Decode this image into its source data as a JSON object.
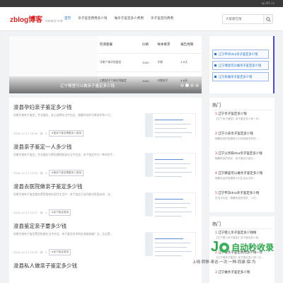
{
  "topbar": {
    "right_text": "sp.0f1.cn"
  },
  "header": {
    "logo_main": "zblog",
    "logo_brand": "博客",
    "slogan": "代码笔记·分享",
    "nav": [
      {
        "label": "首页",
        "active": true
      },
      {
        "label": "亲子鉴定费用多少钱",
        "active": false
      },
      {
        "label": "做亲子鉴定多少费用",
        "active": false
      },
      {
        "label": "亲子鉴定的费用",
        "active": false
      }
    ],
    "search_placeholder": "大家都在搜"
  },
  "slider": {
    "table_headers": [
      "检测套餐",
      "价格",
      "样本要求",
      "报告周期"
    ],
    "table_rows": [
      [
        "牙刷个体识别鉴定",
        "3000",
        "牙刷",
        "4-6天"
      ],
      [
        "口腔拭子个体识别鉴定",
        "3000",
        "口腔拭子",
        "4-6天"
      ]
    ],
    "caption": "辽宁哪里可以做亲子鉴定多少钱",
    "dots": 4,
    "active_dot": 1
  },
  "hot_links": [
    "辽宁怀孕dna亲子鉴定多少钱",
    "辽宁哪里可以做亲子鉴定多少钱",
    "辽宁私做亲子鉴定多少钱"
  ],
  "posts": [
    {
      "title": "浚县孕妇亲子鉴定多少钱",
      "excerpt": "如果生物亲子鉴定，专业服务，安心选择在当今社会，随着科技的不断进步和人们...",
      "date": "2024-12-17 13:00",
      "views": "0",
      "tag": "#做亲子鉴定需要多少费用"
    },
    {
      "title": "浚县亲子鉴定一人多少钱",
      "excerpt": "如果生物亲子鉴定，专业服务与费用透明叙说在当今社会，亲子鉴定作为一种科学手...",
      "date": "2024-12-17 12:55",
      "views": "0",
      "tag": "#做亲子鉴定需要多少费用"
    },
    {
      "title": "浚县去医院做亲子鉴定多少钱",
      "excerpt": "如果生物亲子鉴定服务费用指南在现代生活中，亲子鉴定已成为解决家庭纠纷、法...",
      "date": "2024-12-17 12:47",
      "views": "0",
      "tag": "#亲子鉴定费用"
    },
    {
      "title": "浚县鉴定亲子要多少钱",
      "excerpt": "如果生物亲子鉴定费用指南在当今社会，亲子鉴定技术的应用越来越广泛，无论是...",
      "date": "2024-12-17 12:25",
      "views": "0",
      "tag": "#亲子鉴定费用"
    },
    {
      "title": "浚县私人做亲子鉴定多少钱",
      "excerpt": "",
      "date": "",
      "views": "",
      "tag": ""
    }
  ],
  "sidebar_hot": {
    "title": "热门",
    "items": [
      {
        "rank": "1",
        "title": "辽宁亲子鉴定多少钱",
        "sub": "【辽宁亲子鉴定】亲子鉴定多少钱一次..."
      },
      {
        "rank": "2",
        "title": "辽宁小孩亲子鉴定多少钱",
        "sub": "随着科技的发展和人们对家庭关系的..."
      },
      {
        "rank": "3",
        "title": "辽宁父亲取dna亲子鉴定多少钱",
        "sub": "随着科技的进步，亲子鉴定已成为..."
      },
      {
        "rank": "4",
        "title": "辽宁哪里可以做亲子鉴定多少钱",
        "sub": "随着社会的发展和人们生活水平的..."
      },
      {
        "rank": "5",
        "title": "辽宁怀孕dna亲子鉴定多少钱",
        "sub": "在当今社会，随着科技的进步，人们..."
      }
    ]
  },
  "sidebar_hot2": {
    "title": "热门",
    "items": [
      {
        "rank": "1",
        "title": "辽宁婴儿亲子鉴定多少钱啊",
        "sub": "【辽宁婴儿亲子鉴定】亲子鉴定多少钱..."
      },
      {
        "rank": "2",
        "title": "辽宁做亲子鉴定费用多少钱一次",
        "sub": "【辽宁做亲子鉴定】亲子鉴定多少钱一次..."
      },
      {
        "rank": "3",
        "title": "辽宁做亲子鉴定多少钱",
        "sub": ""
      }
    ]
  },
  "watermark": {
    "brand_text": "自动秒收录",
    "sub_text": "上线·转移·来访·一次·一种·同录·保·为"
  }
}
